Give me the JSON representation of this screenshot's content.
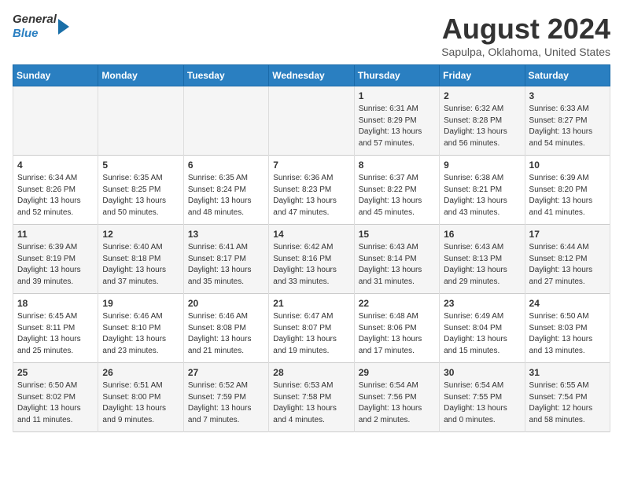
{
  "header": {
    "logo_line1": "General",
    "logo_line2": "Blue",
    "month_title": "August 2024",
    "location": "Sapulpa, Oklahoma, United States"
  },
  "days_of_week": [
    "Sunday",
    "Monday",
    "Tuesday",
    "Wednesday",
    "Thursday",
    "Friday",
    "Saturday"
  ],
  "weeks": [
    [
      {
        "day": "",
        "sunrise": "",
        "sunset": "",
        "daylight": ""
      },
      {
        "day": "",
        "sunrise": "",
        "sunset": "",
        "daylight": ""
      },
      {
        "day": "",
        "sunrise": "",
        "sunset": "",
        "daylight": ""
      },
      {
        "day": "",
        "sunrise": "",
        "sunset": "",
        "daylight": ""
      },
      {
        "day": "1",
        "sunrise": "Sunrise: 6:31 AM",
        "sunset": "Sunset: 8:29 PM",
        "daylight": "Daylight: 13 hours and 57 minutes."
      },
      {
        "day": "2",
        "sunrise": "Sunrise: 6:32 AM",
        "sunset": "Sunset: 8:28 PM",
        "daylight": "Daylight: 13 hours and 56 minutes."
      },
      {
        "day": "3",
        "sunrise": "Sunrise: 6:33 AM",
        "sunset": "Sunset: 8:27 PM",
        "daylight": "Daylight: 13 hours and 54 minutes."
      }
    ],
    [
      {
        "day": "4",
        "sunrise": "Sunrise: 6:34 AM",
        "sunset": "Sunset: 8:26 PM",
        "daylight": "Daylight: 13 hours and 52 minutes."
      },
      {
        "day": "5",
        "sunrise": "Sunrise: 6:35 AM",
        "sunset": "Sunset: 8:25 PM",
        "daylight": "Daylight: 13 hours and 50 minutes."
      },
      {
        "day": "6",
        "sunrise": "Sunrise: 6:35 AM",
        "sunset": "Sunset: 8:24 PM",
        "daylight": "Daylight: 13 hours and 48 minutes."
      },
      {
        "day": "7",
        "sunrise": "Sunrise: 6:36 AM",
        "sunset": "Sunset: 8:23 PM",
        "daylight": "Daylight: 13 hours and 47 minutes."
      },
      {
        "day": "8",
        "sunrise": "Sunrise: 6:37 AM",
        "sunset": "Sunset: 8:22 PM",
        "daylight": "Daylight: 13 hours and 45 minutes."
      },
      {
        "day": "9",
        "sunrise": "Sunrise: 6:38 AM",
        "sunset": "Sunset: 8:21 PM",
        "daylight": "Daylight: 13 hours and 43 minutes."
      },
      {
        "day": "10",
        "sunrise": "Sunrise: 6:39 AM",
        "sunset": "Sunset: 8:20 PM",
        "daylight": "Daylight: 13 hours and 41 minutes."
      }
    ],
    [
      {
        "day": "11",
        "sunrise": "Sunrise: 6:39 AM",
        "sunset": "Sunset: 8:19 PM",
        "daylight": "Daylight: 13 hours and 39 minutes."
      },
      {
        "day": "12",
        "sunrise": "Sunrise: 6:40 AM",
        "sunset": "Sunset: 8:18 PM",
        "daylight": "Daylight: 13 hours and 37 minutes."
      },
      {
        "day": "13",
        "sunrise": "Sunrise: 6:41 AM",
        "sunset": "Sunset: 8:17 PM",
        "daylight": "Daylight: 13 hours and 35 minutes."
      },
      {
        "day": "14",
        "sunrise": "Sunrise: 6:42 AM",
        "sunset": "Sunset: 8:16 PM",
        "daylight": "Daylight: 13 hours and 33 minutes."
      },
      {
        "day": "15",
        "sunrise": "Sunrise: 6:43 AM",
        "sunset": "Sunset: 8:14 PM",
        "daylight": "Daylight: 13 hours and 31 minutes."
      },
      {
        "day": "16",
        "sunrise": "Sunrise: 6:43 AM",
        "sunset": "Sunset: 8:13 PM",
        "daylight": "Daylight: 13 hours and 29 minutes."
      },
      {
        "day": "17",
        "sunrise": "Sunrise: 6:44 AM",
        "sunset": "Sunset: 8:12 PM",
        "daylight": "Daylight: 13 hours and 27 minutes."
      }
    ],
    [
      {
        "day": "18",
        "sunrise": "Sunrise: 6:45 AM",
        "sunset": "Sunset: 8:11 PM",
        "daylight": "Daylight: 13 hours and 25 minutes."
      },
      {
        "day": "19",
        "sunrise": "Sunrise: 6:46 AM",
        "sunset": "Sunset: 8:10 PM",
        "daylight": "Daylight: 13 hours and 23 minutes."
      },
      {
        "day": "20",
        "sunrise": "Sunrise: 6:46 AM",
        "sunset": "Sunset: 8:08 PM",
        "daylight": "Daylight: 13 hours and 21 minutes."
      },
      {
        "day": "21",
        "sunrise": "Sunrise: 6:47 AM",
        "sunset": "Sunset: 8:07 PM",
        "daylight": "Daylight: 13 hours and 19 minutes."
      },
      {
        "day": "22",
        "sunrise": "Sunrise: 6:48 AM",
        "sunset": "Sunset: 8:06 PM",
        "daylight": "Daylight: 13 hours and 17 minutes."
      },
      {
        "day": "23",
        "sunrise": "Sunrise: 6:49 AM",
        "sunset": "Sunset: 8:04 PM",
        "daylight": "Daylight: 13 hours and 15 minutes."
      },
      {
        "day": "24",
        "sunrise": "Sunrise: 6:50 AM",
        "sunset": "Sunset: 8:03 PM",
        "daylight": "Daylight: 13 hours and 13 minutes."
      }
    ],
    [
      {
        "day": "25",
        "sunrise": "Sunrise: 6:50 AM",
        "sunset": "Sunset: 8:02 PM",
        "daylight": "Daylight: 13 hours and 11 minutes."
      },
      {
        "day": "26",
        "sunrise": "Sunrise: 6:51 AM",
        "sunset": "Sunset: 8:00 PM",
        "daylight": "Daylight: 13 hours and 9 minutes."
      },
      {
        "day": "27",
        "sunrise": "Sunrise: 6:52 AM",
        "sunset": "Sunset: 7:59 PM",
        "daylight": "Daylight: 13 hours and 7 minutes."
      },
      {
        "day": "28",
        "sunrise": "Sunrise: 6:53 AM",
        "sunset": "Sunset: 7:58 PM",
        "daylight": "Daylight: 13 hours and 4 minutes."
      },
      {
        "day": "29",
        "sunrise": "Sunrise: 6:54 AM",
        "sunset": "Sunset: 7:56 PM",
        "daylight": "Daylight: 13 hours and 2 minutes."
      },
      {
        "day": "30",
        "sunrise": "Sunrise: 6:54 AM",
        "sunset": "Sunset: 7:55 PM",
        "daylight": "Daylight: 13 hours and 0 minutes."
      },
      {
        "day": "31",
        "sunrise": "Sunrise: 6:55 AM",
        "sunset": "Sunset: 7:54 PM",
        "daylight": "Daylight: 12 hours and 58 minutes."
      }
    ]
  ]
}
